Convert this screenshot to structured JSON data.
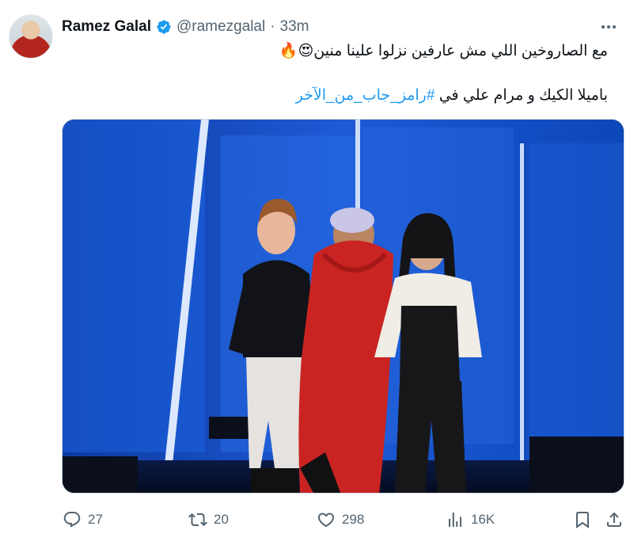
{
  "author": {
    "name": "Ramez Galal",
    "handle": "@ramezgalal",
    "separator": "·",
    "time": "33m"
  },
  "tweet": {
    "line1": "مع الصاروخين اللي مش عارفين نزلوا علينا منين😍🔥",
    "line2_prefix": "باميلا الكيك و مرام علي في ",
    "hashtag": "#رامز_جاب_من_الآخر"
  },
  "actions": {
    "replies": "27",
    "reposts": "20",
    "likes": "298",
    "views": "16K"
  },
  "colors": {
    "accent": "#1d9bf0",
    "text": "#0f1419",
    "muted": "#536471"
  },
  "icons": [
    "verified-badge-icon",
    "more-icon",
    "reply-icon",
    "repost-icon",
    "like-icon",
    "views-icon",
    "bookmark-icon",
    "share-icon"
  ]
}
